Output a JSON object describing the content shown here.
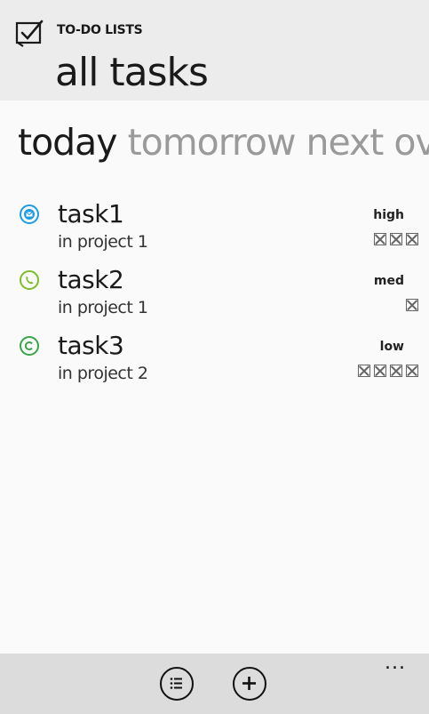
{
  "header": {
    "app_name": "TO-DO LISTS",
    "page_title": "all tasks"
  },
  "pivot": {
    "items": [
      "today",
      "tomorrow",
      "next ov"
    ],
    "active_index": 0
  },
  "tasks": [
    {
      "name": "task1",
      "project": "in project 1",
      "priority": "high",
      "marks": 3,
      "icon": "email-icon",
      "icon_color": "#1f9bde"
    },
    {
      "name": "task2",
      "project": "in project 1",
      "priority": "med",
      "marks": 1,
      "icon": "phone-icon",
      "icon_color": "#7dbb2f"
    },
    {
      "name": "task3",
      "project": "in project 2",
      "priority": "low",
      "marks": 4,
      "icon": "c-icon",
      "icon_color": "#3aa44a"
    }
  ],
  "appbar": {
    "more_label": "...",
    "buttons": [
      "list-icon",
      "add-icon"
    ]
  }
}
